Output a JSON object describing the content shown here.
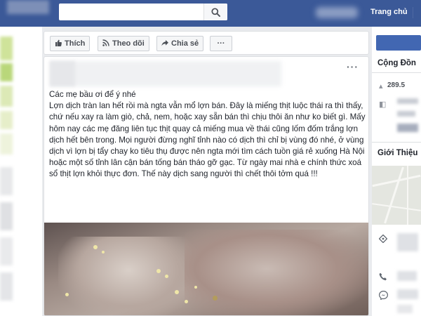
{
  "header": {
    "home_label": "Trang chủ"
  },
  "action_bar": {
    "like_label": "Thích",
    "follow_label": "Theo dõi",
    "share_label": "Chia sẻ",
    "more_label": "···"
  },
  "post": {
    "more_label": "···",
    "paragraphs": [
      "Các mẹ bầu ơi để ý nhé",
      "Lợn dịch tràn lan hết rồi mà ngta vẫn mổ lợn bán. Đây là miếng thịt luộc thái ra thì thấy, chứ nếu xay ra làm giò, chả, nem, hoặc xay sẵn bán thì chịu thôi ăn như ko biết gì. Mấy hôm nay các mẹ đăng liên tục thịt quay cả miếng mua về thái cũng lốm đốm trắng lợn dịch hết bên trong. Mọi người đừng nghĩ tỉnh nào có dịch thì chỉ bị vùng đó nhé, ở vùng dịch vì lợn bị tẩy chay ko tiêu thụ được nên ngta mới tìm cách tuồn giá rẻ xuống Hà Nội hoặc một số tỉnh lân cận bán tống bán tháo gỡ gạc. Từ ngày mai nhà e chính thức xoá sổ thịt lợn khỏi thực đơn. Thế này dịch sang người thì chết thôi tởm quá !!!"
    ]
  },
  "right_column": {
    "community_title": "Cộng Đồn",
    "community_count": "289.5",
    "about_title": "Giới Thiệu"
  },
  "colors": {
    "topbar": "#3b5998",
    "accent": "#4267b2",
    "background": "#e9ebee"
  },
  "icons": {
    "search": "search-icon",
    "like": "thumbs-up-icon",
    "follow": "rss-icon",
    "share": "share-arrow-icon",
    "pin": "location-pin-icon",
    "phone": "phone-icon",
    "messenger": "messenger-icon"
  }
}
